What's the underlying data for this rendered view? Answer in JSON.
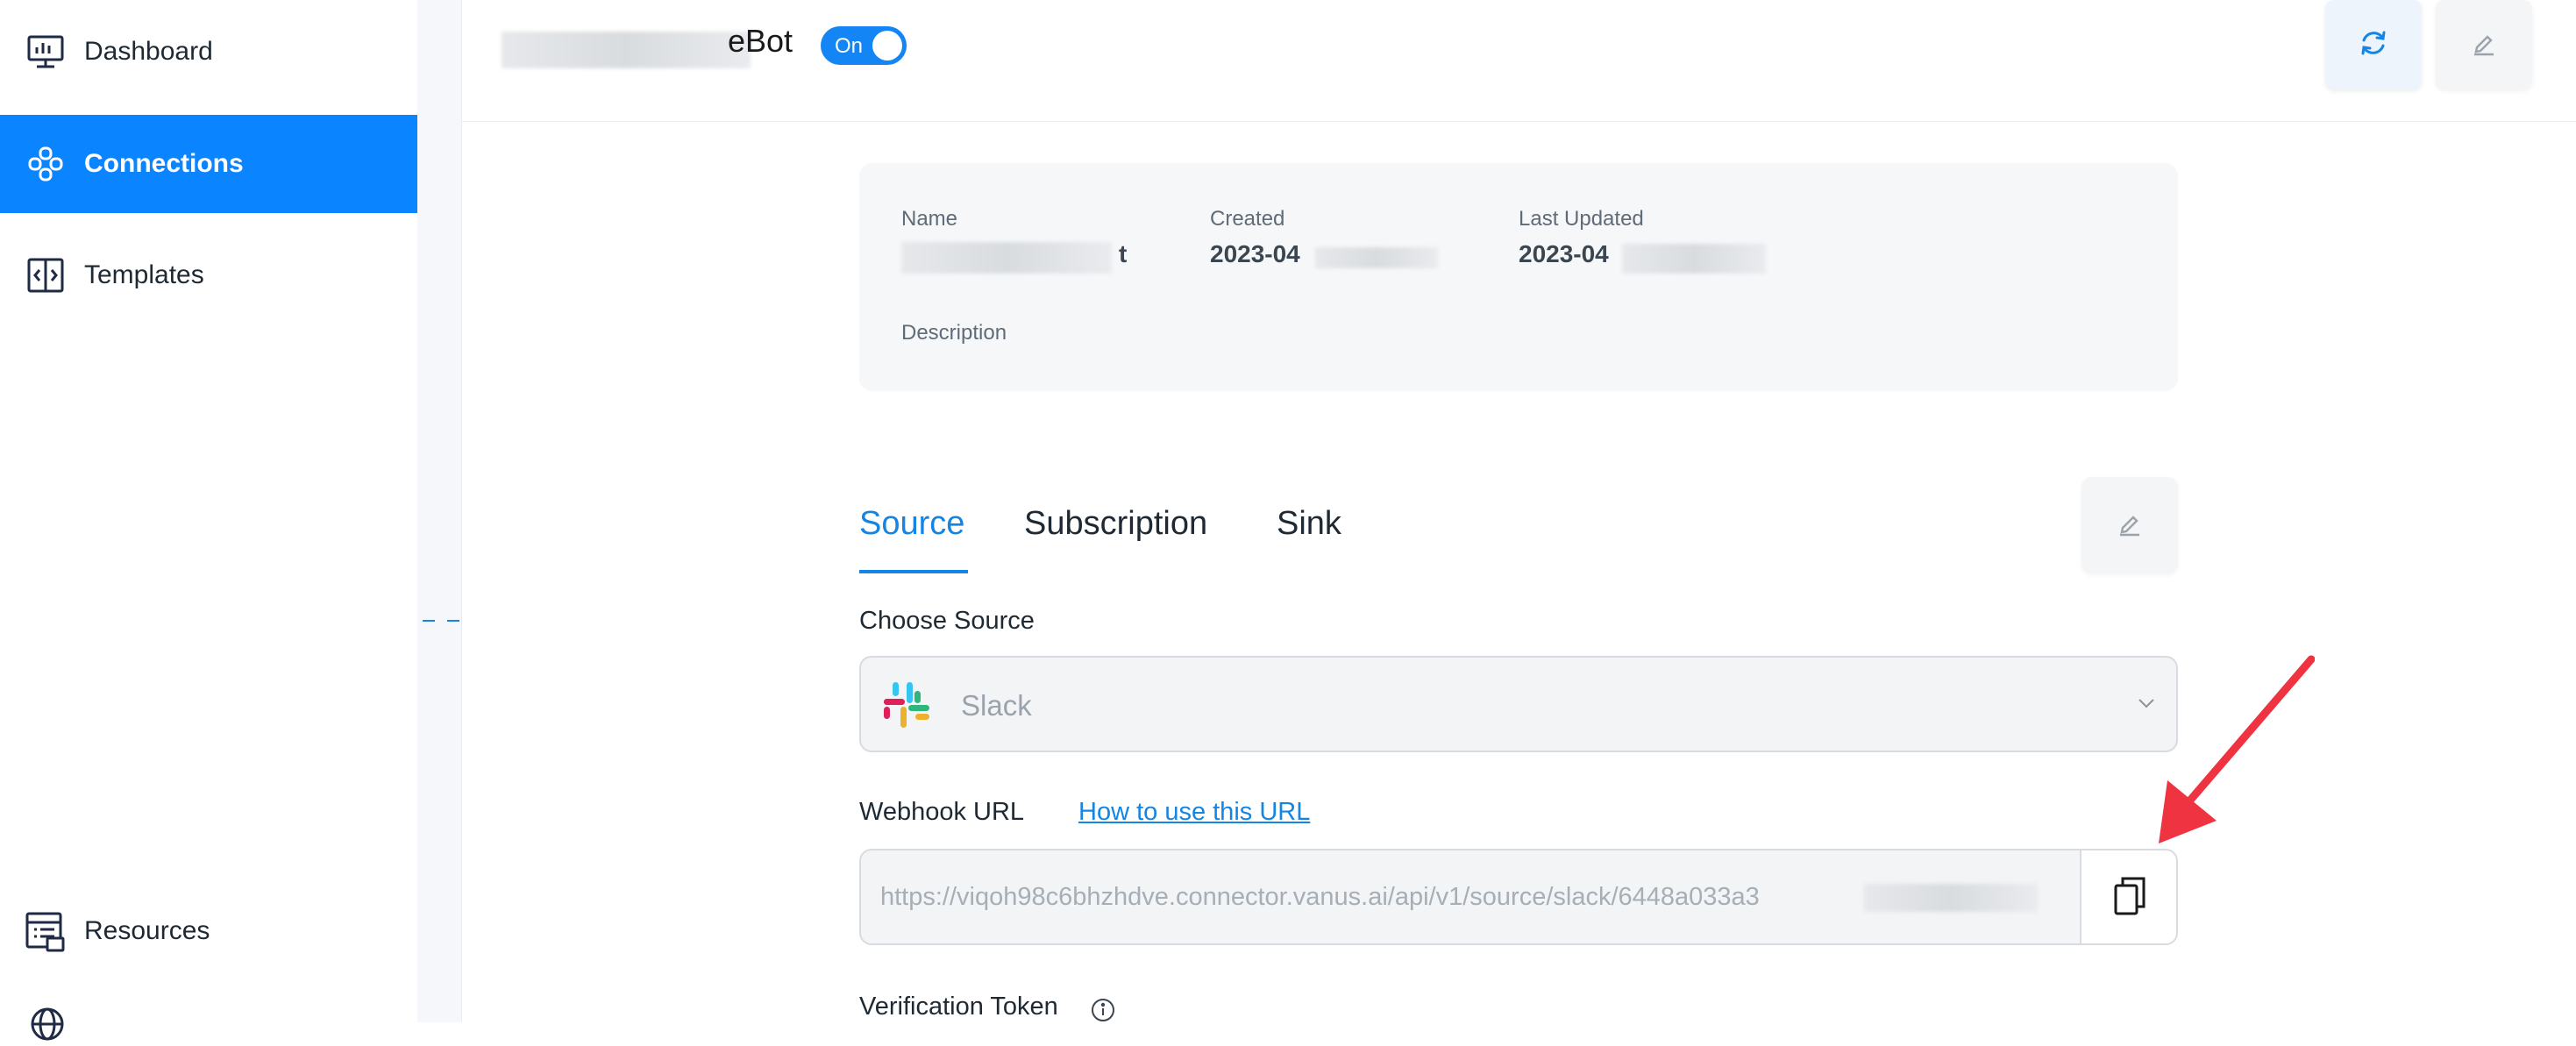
{
  "sidebar": {
    "items": [
      {
        "label": "Dashboard",
        "icon": "dashboard-icon",
        "active": false
      },
      {
        "label": "Connections",
        "icon": "connections-icon",
        "active": true
      },
      {
        "label": "Templates",
        "icon": "templates-icon",
        "active": false
      },
      {
        "label": "Resources",
        "icon": "resources-icon",
        "active": false
      }
    ]
  },
  "header": {
    "title_visible": "eBot",
    "toggle_label": "On",
    "toggle_on": true
  },
  "info": {
    "name_label": "Name",
    "name_value_visible": "t",
    "created_label": "Created",
    "created_value_visible": "2023-04",
    "updated_label": "Last Updated",
    "updated_value_visible": "2023-04",
    "description_label": "Description"
  },
  "tabs": [
    {
      "label": "Source",
      "active": true
    },
    {
      "label": "Subscription",
      "active": false
    },
    {
      "label": "Sink",
      "active": false
    }
  ],
  "source": {
    "choose_label": "Choose Source",
    "selected": "Slack",
    "webhook_label": "Webhook URL",
    "webhook_link": "How to use this URL",
    "webhook_value": "https://viqoh98c6bhzhdve.connector.vanus.ai/api/v1/source/slack/6448a033a3",
    "verification_label": "Verification Token"
  },
  "colors": {
    "accent": "#0a84ff",
    "link": "#1585e4",
    "annotation_arrow": "#ef3340"
  }
}
